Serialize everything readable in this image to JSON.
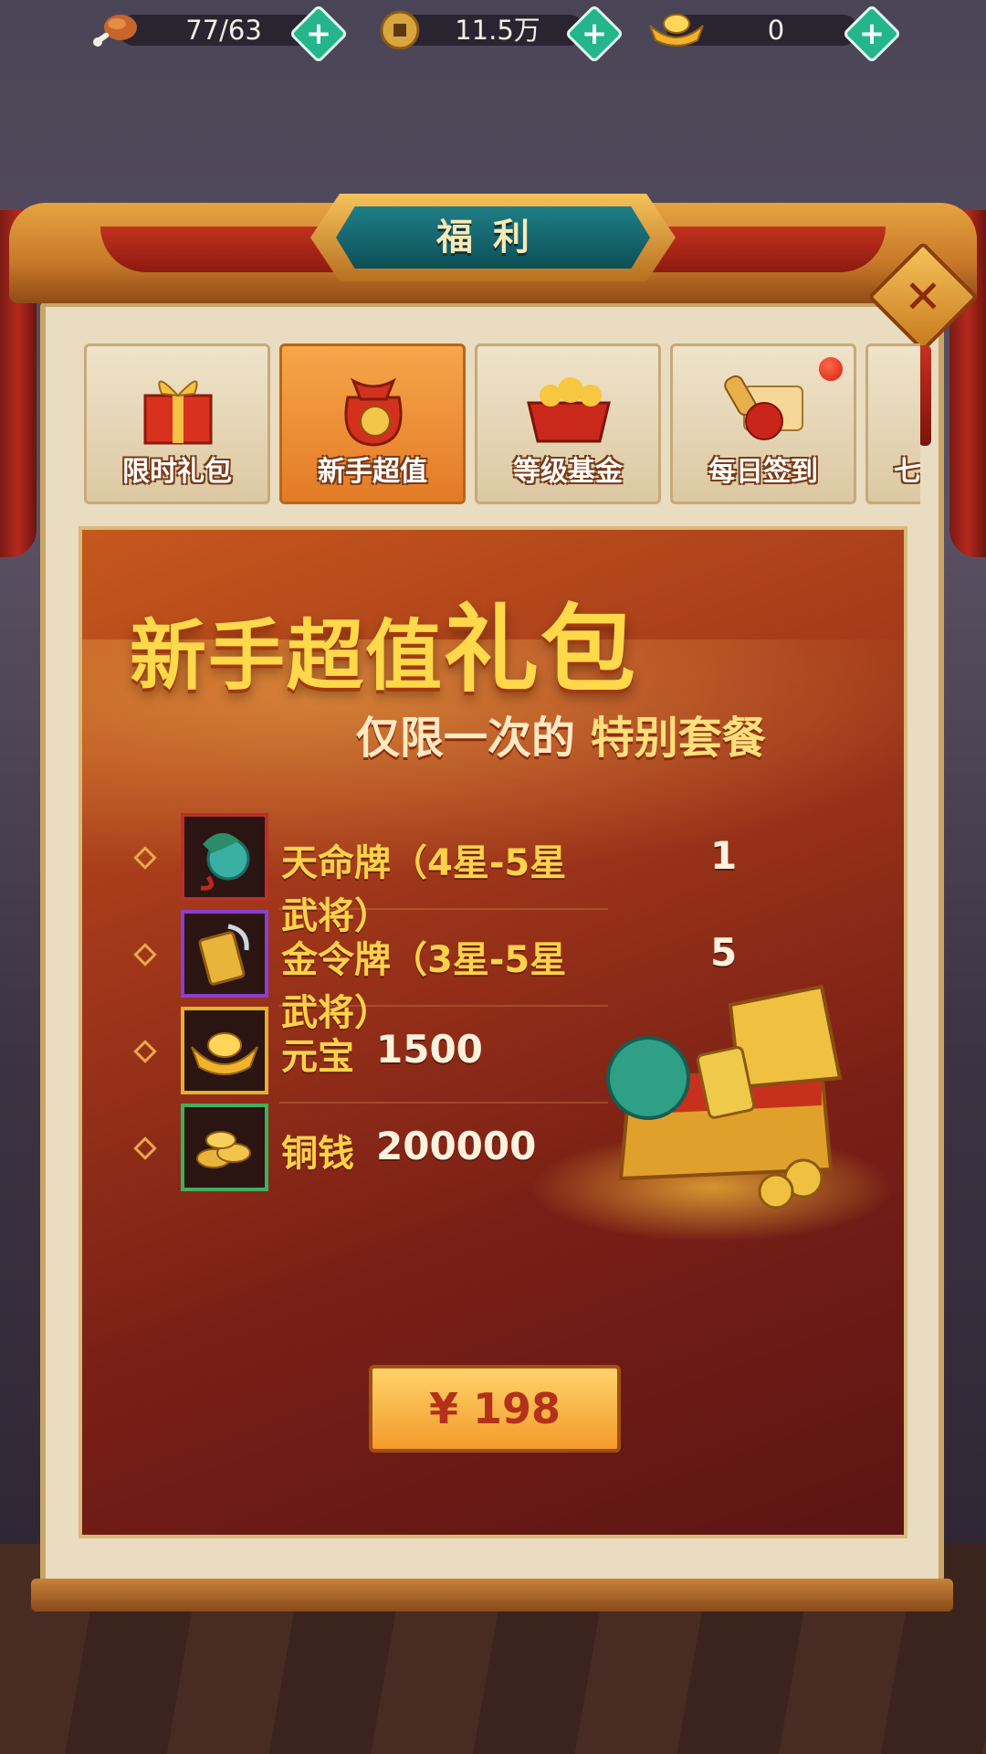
{
  "resources": [
    {
      "icon": "meat-icon",
      "value": "77/63"
    },
    {
      "icon": "copper-coin-icon",
      "value": "11.5万"
    },
    {
      "icon": "gold-ingot-icon",
      "value": "0"
    }
  ],
  "panel": {
    "title": "福利",
    "tabs": [
      {
        "label": "限时礼包",
        "icon": "gift-box-icon",
        "active": false
      },
      {
        "label": "新手超值",
        "icon": "lucky-bag-icon",
        "active": true
      },
      {
        "label": "等级基金",
        "icon": "treasure-basin-icon",
        "active": false
      },
      {
        "label": "每日签到",
        "icon": "scroll-seal-icon",
        "active": false,
        "badge": true
      },
      {
        "label": "七",
        "icon": "tab-partial-icon",
        "active": false
      }
    ]
  },
  "content": {
    "title_part1": "新手超值",
    "title_part2": "礼包",
    "subtitle_part1": "仅限一次的",
    "subtitle_part2": "特别套餐",
    "items": [
      {
        "name": "天命牌（4星-5星武将）",
        "qty": "1",
        "icon": "jade-fish-token-icon",
        "border": "#b9302a"
      },
      {
        "name": "金令牌（3星-5星武将）",
        "qty": "5",
        "icon": "gold-token-icon",
        "border": "#8a3fd1"
      },
      {
        "name": "元宝",
        "qty": "1500",
        "icon": "yuanbao-icon",
        "border": "#e4b02f"
      },
      {
        "name": "铜钱",
        "qty": "200000",
        "icon": "coins-icon",
        "border": "#3fb05a"
      }
    ],
    "price": "¥ 198"
  }
}
